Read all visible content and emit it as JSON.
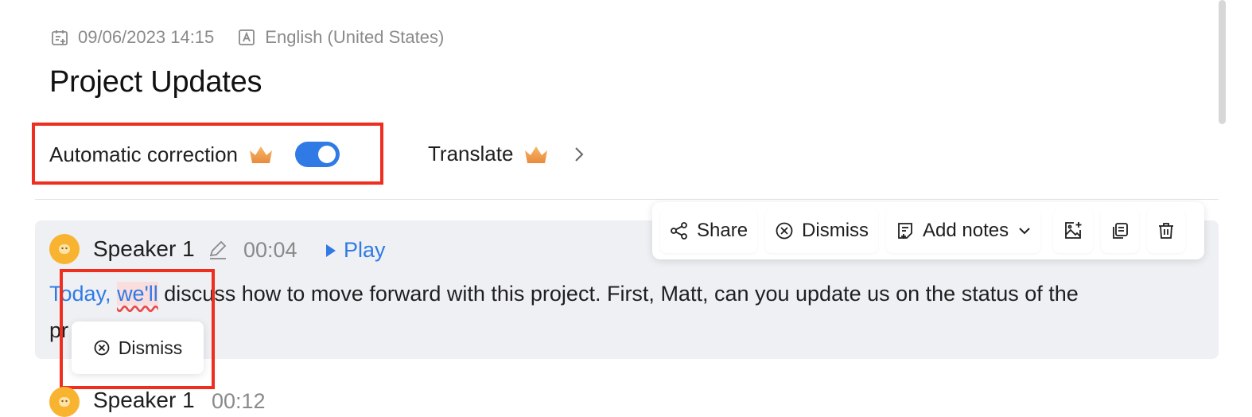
{
  "meta": {
    "date": "09/06/2023 14:15",
    "language": "English (United States)",
    "icons": [
      "calendar-icon",
      "language-icon"
    ]
  },
  "title": "Project Updates",
  "options": {
    "auto_correction": {
      "label": "Automatic correction",
      "enabled": true,
      "premium_icon": "crown-icon"
    },
    "translate": {
      "label": "Translate",
      "premium_icon": "crown-icon",
      "chevron": "chevron-right-icon"
    }
  },
  "toolbar": {
    "share": "Share",
    "dismiss": "Dismiss",
    "add_notes": "Add notes",
    "icons": [
      "share-icon",
      "dismiss-icon",
      "notes-icon",
      "chevron-down-icon",
      "add-image-icon",
      "copy-icon",
      "trash-icon"
    ]
  },
  "segments": [
    {
      "speaker": "Speaker 1",
      "time": "00:04",
      "play_label": "Play",
      "text_prefix": "Today, ",
      "text_error": "we'll",
      "text_rest": " discuss how to move forward with this project. First, Matt, can you update us on the status of the",
      "text_line2": "pr"
    },
    {
      "speaker": "Speaker 1",
      "time": "00:12"
    }
  ],
  "popup": {
    "dismiss": "Dismiss"
  },
  "colors": {
    "accent": "#2f7ae5",
    "highlight_box": "#ee2e1e",
    "avatar": "#f8b431",
    "crown": "#f0a04b"
  }
}
